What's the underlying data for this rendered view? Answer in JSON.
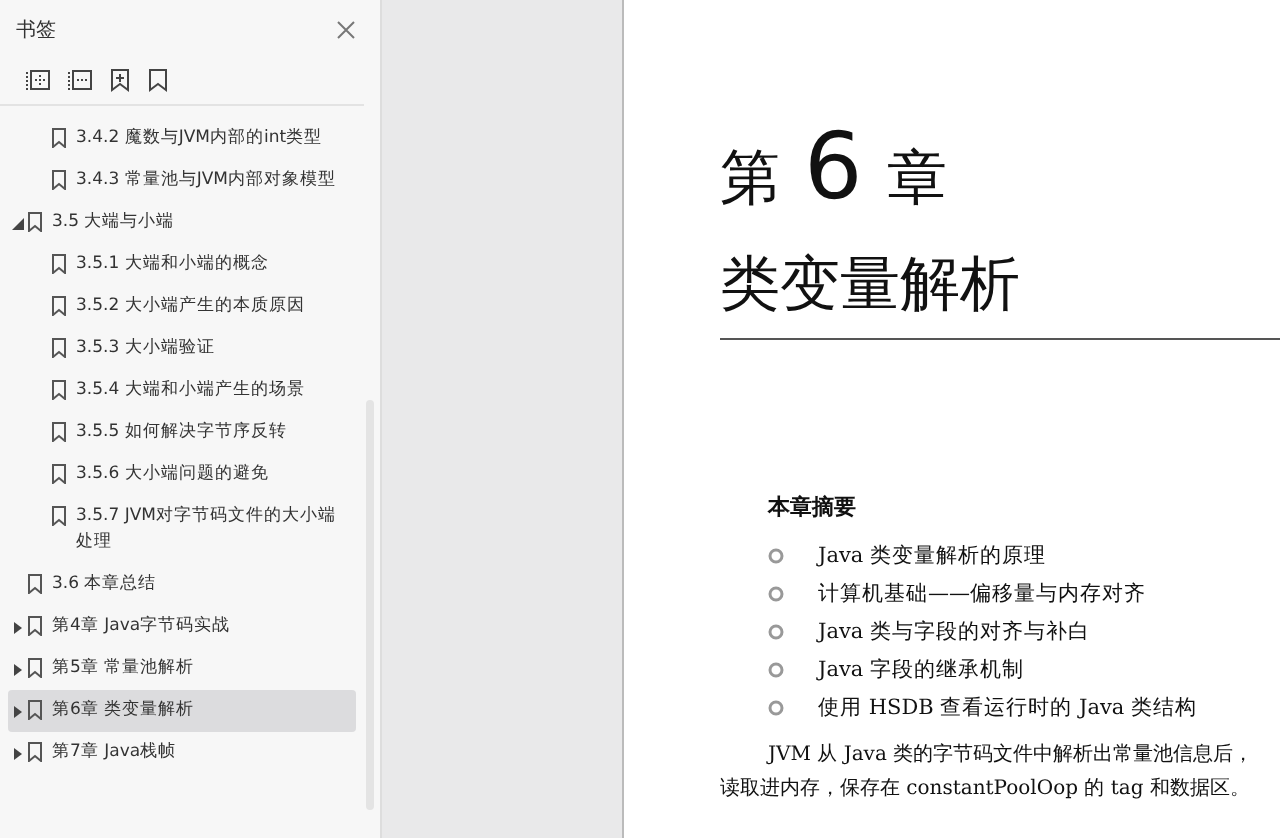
{
  "sidebar": {
    "title": "书签",
    "bookmarks": [
      {
        "children": [
          {
            "children": [
              {
                "label": "3.4.2 魔数与JVM内部的int类型",
                "selected": false
              },
              {
                "label": "3.4.3 常量池与JVM内部对象模型",
                "selected": false
              }
            ]
          },
          {
            "label": "3.5 大端与小端",
            "expanded": true,
            "selected": false,
            "children": [
              {
                "label": "3.5.1 大端和小端的概念",
                "selected": false
              },
              {
                "label": "3.5.2 大小端产生的本质原因",
                "selected": false
              },
              {
                "label": "3.5.3 大小端验证",
                "selected": false
              },
              {
                "label": "3.5.4 大端和小端产生的场景",
                "selected": false
              },
              {
                "label": "3.5.5 如何解决字节序反转",
                "selected": false
              },
              {
                "label": "3.5.6 大小端问题的避免",
                "selected": false
              },
              {
                "label": "3.5.7 JVM对字节码文件的大小端处理",
                "selected": false
              }
            ]
          },
          {
            "label": "3.6 本章总结",
            "selected": false
          }
        ]
      },
      {
        "label": "第4章 Java字节码实战",
        "expanded": false,
        "selected": false
      },
      {
        "label": "第5章 常量池解析",
        "expanded": false,
        "selected": false
      },
      {
        "label": "第6章 类变量解析",
        "expanded": false,
        "selected": true
      },
      {
        "label": "第7章 Java栈帧",
        "expanded": false,
        "selected": false
      }
    ]
  },
  "page": {
    "chapter_prefix": "第",
    "chapter_number": "6",
    "chapter_suffix": "章",
    "title": "类变量解析",
    "summary_heading": "本章摘要",
    "summary_items": [
      "Java 类变量解析的原理",
      "计算机基础——偏移量与内存对齐",
      "Java 类与字段的对齐与补白",
      "Java 字段的继承机制",
      "使用 HSDB 查看运行时的 Java 类结构"
    ],
    "paragraph": [
      "JVM 从 Java 类的字节码文件中解析出常量池信息后，",
      "读取进内存，保存在 constantPoolOop 的 tag 和数据区。"
    ]
  }
}
